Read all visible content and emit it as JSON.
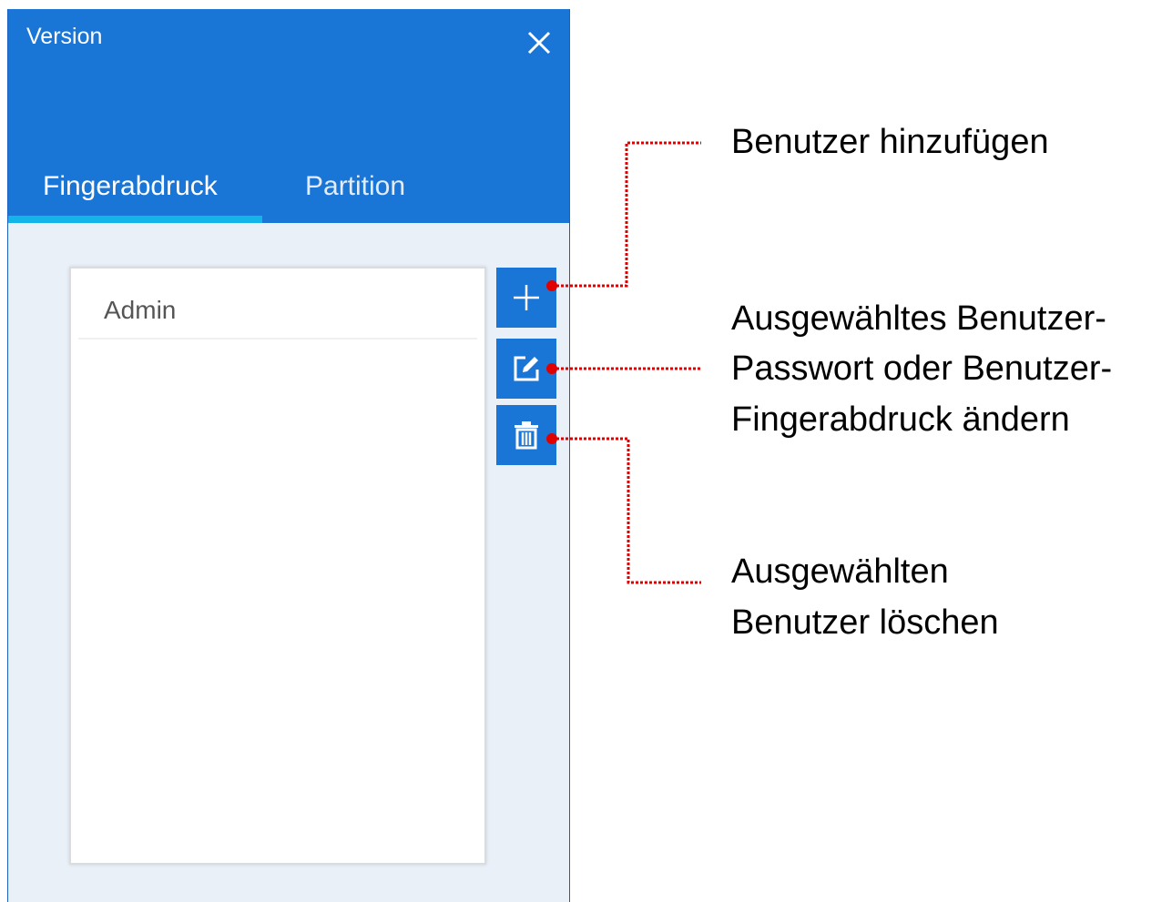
{
  "window": {
    "title": "Version",
    "close_icon": "close-icon"
  },
  "tabs": [
    {
      "label": "Fingerabdruck",
      "active": true
    },
    {
      "label": "Partition",
      "active": false
    }
  ],
  "user_list": {
    "items": [
      "Admin"
    ]
  },
  "actions": [
    {
      "icon": "plus-icon"
    },
    {
      "icon": "edit-icon"
    },
    {
      "icon": "trash-icon"
    }
  ],
  "annotations": {
    "add": {
      "line1": "Benutzer hinzufügen"
    },
    "edit": {
      "line1": "Ausgewähltes Benutzer-",
      "line2": "Passwort oder Benutzer-",
      "line3": "Fingerabdruck ändern"
    },
    "delete": {
      "line1": "Ausgewählten",
      "line2": "Benutzer löschen"
    }
  },
  "colors": {
    "header": "#1976d6",
    "tab_underline": "#13b4e8",
    "callout": "#e00000",
    "panel_bg": "#eaf0f7"
  }
}
